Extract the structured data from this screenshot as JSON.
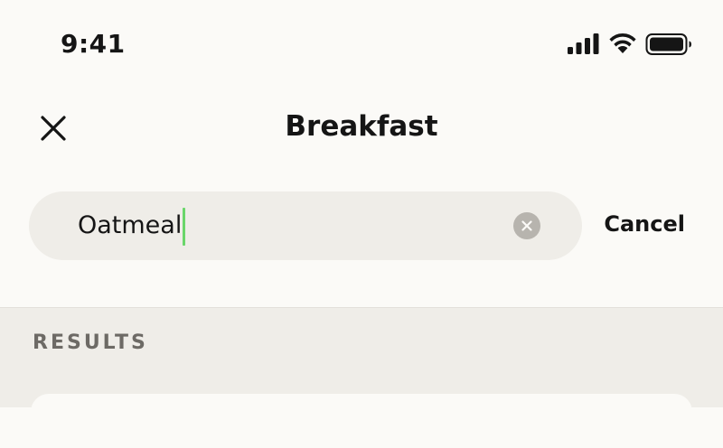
{
  "status_bar": {
    "time": "9:41",
    "icons": [
      "cellular-signal-icon",
      "wifi-icon",
      "battery-icon"
    ]
  },
  "nav": {
    "title": "Breakfast",
    "close_icon": "close-icon"
  },
  "search": {
    "value": "Oatmeal",
    "clear_icon": "clear-icon",
    "cancel_label": "Cancel",
    "caret_color": "#6ad66a"
  },
  "results": {
    "header": "RESULTS"
  },
  "colors": {
    "background": "#fbfaf7",
    "search_field": "#efede8",
    "results_background": "#efede8",
    "text": "#151515",
    "secondary_text": "#6d6a65",
    "clear_button": "#b7b4ae"
  }
}
